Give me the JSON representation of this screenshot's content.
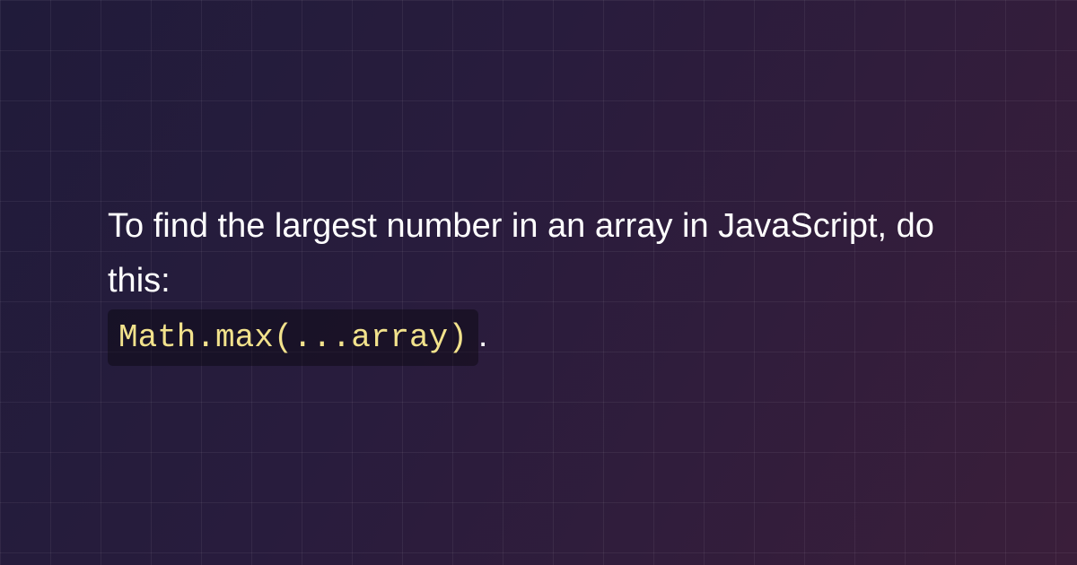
{
  "content": {
    "intro_text": "To find the largest number in an array in JavaScript, do this:",
    "code_snippet": "Math.max(...array)",
    "trailing_punctuation": "."
  }
}
